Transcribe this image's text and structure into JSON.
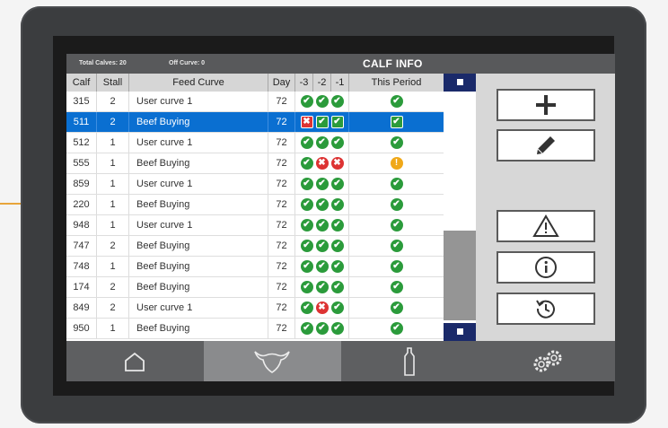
{
  "header": {
    "total_calves": "Total Calves: 20",
    "off_curve": "Off Curve: 0",
    "title": "CALF INFO"
  },
  "table": {
    "columns": [
      "Calf",
      "Stall",
      "Feed Curve",
      "Day",
      "-3",
      "-2",
      "-1",
      "This Period"
    ],
    "rows": [
      {
        "calf": "315",
        "stall": "2",
        "curve": "User curve 1",
        "day": "72",
        "h": [
          "ok",
          "ok",
          "ok"
        ],
        "p": "ok",
        "selected": false
      },
      {
        "calf": "511",
        "stall": "2",
        "curve": "Beef Buying",
        "day": "72",
        "h": [
          "bad",
          "ok",
          "ok"
        ],
        "p": "ok",
        "selected": true
      },
      {
        "calf": "512",
        "stall": "1",
        "curve": "User curve 1",
        "day": "72",
        "h": [
          "ok",
          "ok",
          "ok"
        ],
        "p": "ok",
        "selected": false
      },
      {
        "calf": "555",
        "stall": "1",
        "curve": "Beef Buying",
        "day": "72",
        "h": [
          "ok",
          "bad",
          "bad"
        ],
        "p": "warn",
        "selected": false
      },
      {
        "calf": "859",
        "stall": "1",
        "curve": "User curve 1",
        "day": "72",
        "h": [
          "ok",
          "ok",
          "ok"
        ],
        "p": "ok",
        "selected": false
      },
      {
        "calf": "220",
        "stall": "1",
        "curve": "Beef Buying",
        "day": "72",
        "h": [
          "ok",
          "ok",
          "ok"
        ],
        "p": "ok",
        "selected": false
      },
      {
        "calf": "948",
        "stall": "1",
        "curve": "User curve 1",
        "day": "72",
        "h": [
          "ok",
          "ok",
          "ok"
        ],
        "p": "ok",
        "selected": false
      },
      {
        "calf": "747",
        "stall": "2",
        "curve": "Beef Buying",
        "day": "72",
        "h": [
          "ok",
          "ok",
          "ok"
        ],
        "p": "ok",
        "selected": false
      },
      {
        "calf": "748",
        "stall": "1",
        "curve": "Beef Buying",
        "day": "72",
        "h": [
          "ok",
          "ok",
          "ok"
        ],
        "p": "ok",
        "selected": false
      },
      {
        "calf": "174",
        "stall": "2",
        "curve": "Beef Buying",
        "day": "72",
        "h": [
          "ok",
          "ok",
          "ok"
        ],
        "p": "ok",
        "selected": false
      },
      {
        "calf": "849",
        "stall": "2",
        "curve": "User curve 1",
        "day": "72",
        "h": [
          "ok",
          "bad",
          "ok"
        ],
        "p": "ok",
        "selected": false
      },
      {
        "calf": "950",
        "stall": "1",
        "curve": "Beef Buying",
        "day": "72",
        "h": [
          "ok",
          "ok",
          "ok"
        ],
        "p": "ok",
        "selected": false
      }
    ]
  },
  "side_buttons": [
    {
      "name": "add-button",
      "icon": "plus-icon"
    },
    {
      "name": "edit-button",
      "icon": "pencil-icon"
    },
    {
      "name": "alarm-button",
      "icon": "warning-icon"
    },
    {
      "name": "info-button",
      "icon": "info-icon"
    },
    {
      "name": "history-button",
      "icon": "history-icon"
    }
  ],
  "nav": [
    {
      "name": "tab-home",
      "icon": "home-icon",
      "active": false
    },
    {
      "name": "tab-calves",
      "icon": "calf-icon",
      "active": true
    },
    {
      "name": "tab-milk",
      "icon": "bottle-icon",
      "active": false
    },
    {
      "name": "tab-settings",
      "icon": "gears-icon",
      "active": false
    }
  ],
  "colors": {
    "selected_row": "#0a6fd1",
    "ok": "#2b9b3b",
    "bad": "#dd3333",
    "warn": "#f0a818",
    "callout": "#e7a43a",
    "scroll_button": "#1a2a6a"
  }
}
